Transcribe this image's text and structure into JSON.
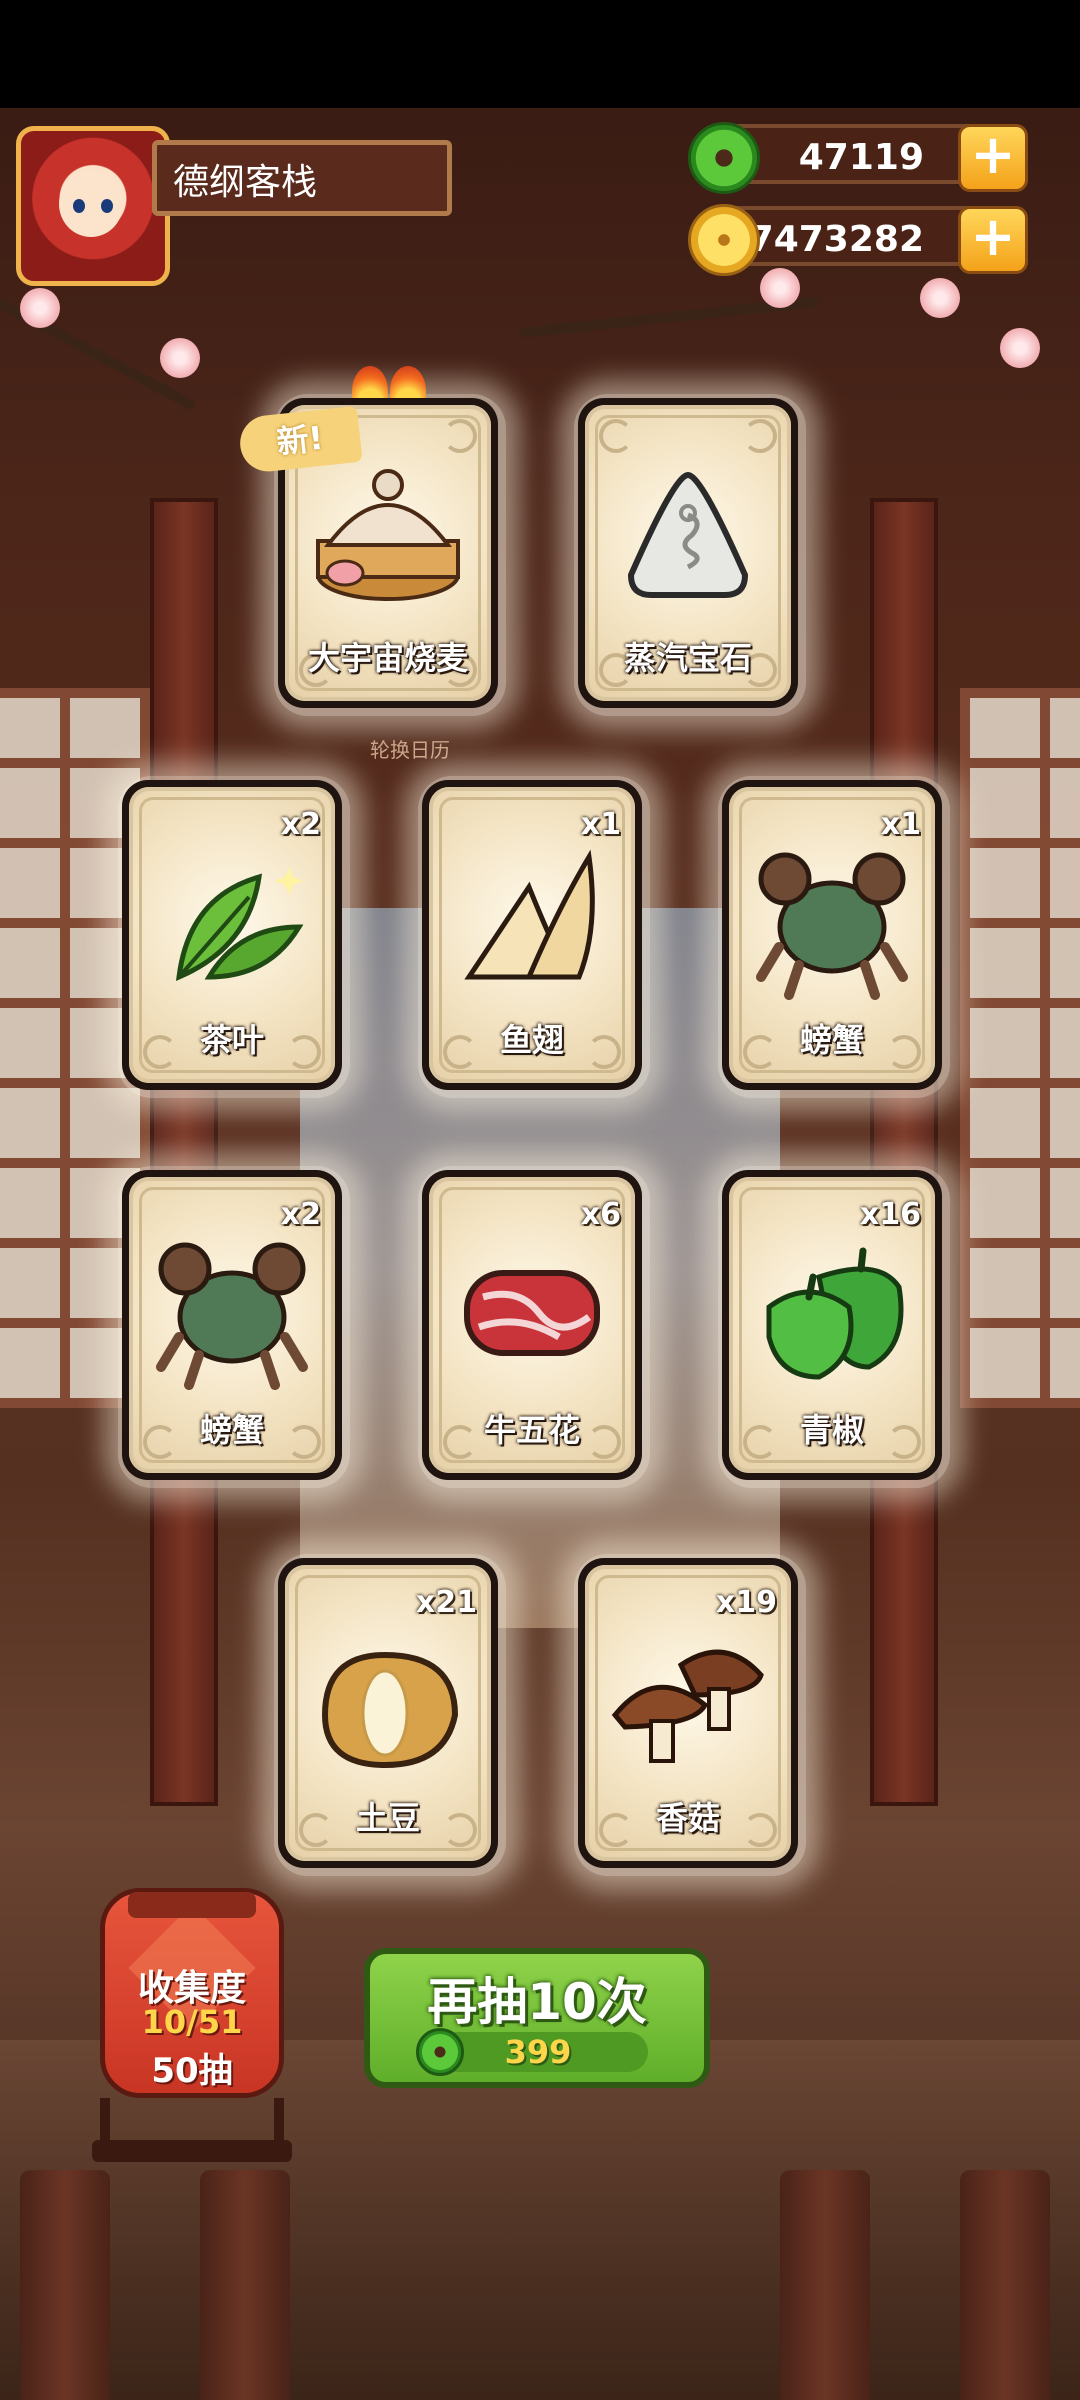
{
  "header": {
    "shop_name": "德纲客栈",
    "jade": "47119",
    "coins": "7473282",
    "plus_symbol": "+"
  },
  "featured": {
    "new_tag": "新!",
    "subtitle": "轮换日历"
  },
  "cards": [
    {
      "name": "大宇宙烧麦",
      "count": "",
      "icon": "shaomai-dumpling-icon"
    },
    {
      "name": "蒸汽宝石",
      "count": "",
      "icon": "steam-gem-icon"
    },
    {
      "name": "茶叶",
      "count": "x2",
      "icon": "tea-leaf-icon"
    },
    {
      "name": "鱼翅",
      "count": "x1",
      "icon": "shark-fin-icon"
    },
    {
      "name": "螃蟹",
      "count": "x1",
      "icon": "crab-icon"
    },
    {
      "name": "螃蟹",
      "count": "x2",
      "icon": "crab-icon"
    },
    {
      "name": "牛五花",
      "count": "x6",
      "icon": "beef-slice-icon"
    },
    {
      "name": "青椒",
      "count": "x16",
      "icon": "green-pepper-icon"
    },
    {
      "name": "土豆",
      "count": "x21",
      "icon": "potato-icon"
    },
    {
      "name": "香菇",
      "count": "x19",
      "icon": "mushroom-icon"
    }
  ],
  "collection": {
    "label": "收集度",
    "progress": "10/51",
    "pulls": "50抽"
  },
  "draw": {
    "label": "再抽10次",
    "cost": "399"
  },
  "colors": {
    "accent_green": "#5fae2a",
    "gold": "#f4a21a",
    "card_bg": "#f3e3c2"
  }
}
